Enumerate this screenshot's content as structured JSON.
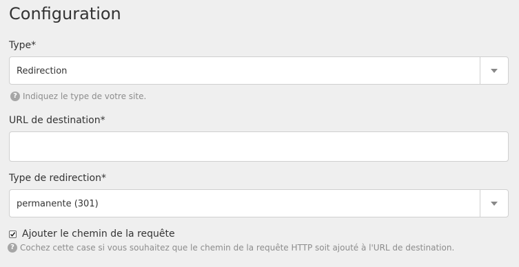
{
  "section": {
    "title": "Configuration"
  },
  "type_field": {
    "label": "Type*",
    "value": "Redirection",
    "help": "Indiquez le type de votre site."
  },
  "url_field": {
    "label": "URL de destination*",
    "value": "",
    "placeholder": ""
  },
  "redirect_type_field": {
    "label": "Type de redirection*",
    "value": "permanente (301)"
  },
  "append_path": {
    "label": "Ajouter le chemin de la requête",
    "checked": true,
    "help": "Cochez cette case si vous souhaitez que le chemin de la requête HTTP soit ajouté à l'URL de destination."
  },
  "icons": {
    "help": "question-circle-icon",
    "dropdown": "caret-down-icon",
    "check": "check-icon"
  }
}
